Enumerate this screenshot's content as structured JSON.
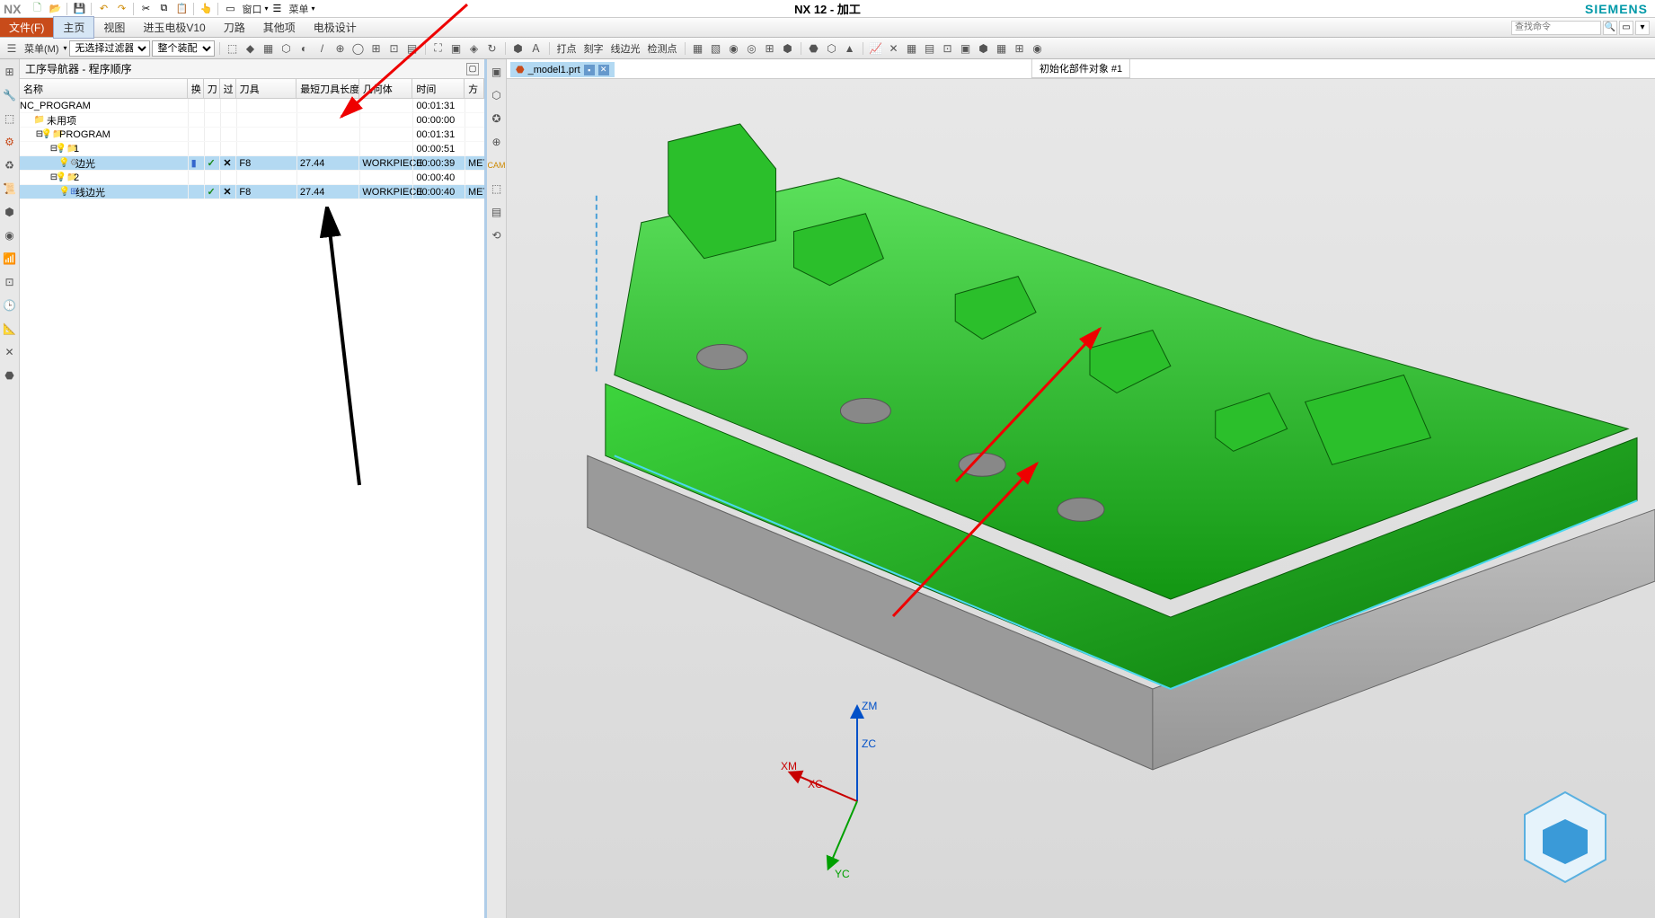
{
  "app": {
    "name": "NX",
    "title": "NX 12 - 加工",
    "brand": "SIEMENS"
  },
  "titlebar_menu": {
    "window": "窗口",
    "menu": "菜单"
  },
  "menubar": {
    "file": "文件(F)",
    "items": [
      "主页",
      "视图",
      "进玉电极V10",
      "刀路",
      "其他项",
      "电极设计"
    ]
  },
  "search": {
    "placeholder": "查找命令"
  },
  "toolbar": {
    "menu_btn": "菜单(M)",
    "filter1": "无选择过滤器",
    "filter2": "整个装配",
    "labels": [
      "打点",
      "刻字",
      "线边光",
      "检测点"
    ]
  },
  "viewport": {
    "banner": "初始化部件对象 #1",
    "tab": "_model1.prt"
  },
  "axes": {
    "zm": "ZM",
    "zc": "ZC",
    "xm": "XM",
    "xc": "XC",
    "yc": "YC"
  },
  "navigator": {
    "title": "工序导航器 - 程序顺序",
    "columns": {
      "name": "名称",
      "h": "换",
      "d": "刀",
      "g": "过",
      "tool": "刀具",
      "len": "最短刀具长度",
      "geo": "几何体",
      "time": "时间",
      "met": "方"
    },
    "rows": [
      {
        "indent": 0,
        "exp": "",
        "icon": "",
        "label": "NC_PROGRAM",
        "time": "00:01:31"
      },
      {
        "indent": 1,
        "exp": "",
        "icon": "folder",
        "label": "未用项",
        "time": "00:00:00"
      },
      {
        "indent": 1,
        "exp": "-",
        "icon": "folder-b",
        "label": "PROGRAM",
        "time": "00:01:31"
      },
      {
        "indent": 2,
        "exp": "-",
        "icon": "folder-b",
        "label": "1",
        "time": "00:00:51"
      },
      {
        "indent": 3,
        "exp": "",
        "icon": "op",
        "label": "边光",
        "sel": true,
        "h": "▮",
        "d": "✓",
        "g": "✕",
        "tool": "F8",
        "len": "27.44",
        "geo": "WORKPIECE",
        "time": "00:00:39",
        "met": "MET"
      },
      {
        "indent": 2,
        "exp": "-",
        "icon": "folder-b",
        "label": "2",
        "time": "00:00:40"
      },
      {
        "indent": 3,
        "exp": "",
        "icon": "op2",
        "label": "线边光",
        "sel": true,
        "d": "✓",
        "g": "✕",
        "tool": "F8",
        "len": "27.44",
        "geo": "WORKPIECE",
        "time": "00:00:40",
        "met": "MET"
      }
    ]
  }
}
